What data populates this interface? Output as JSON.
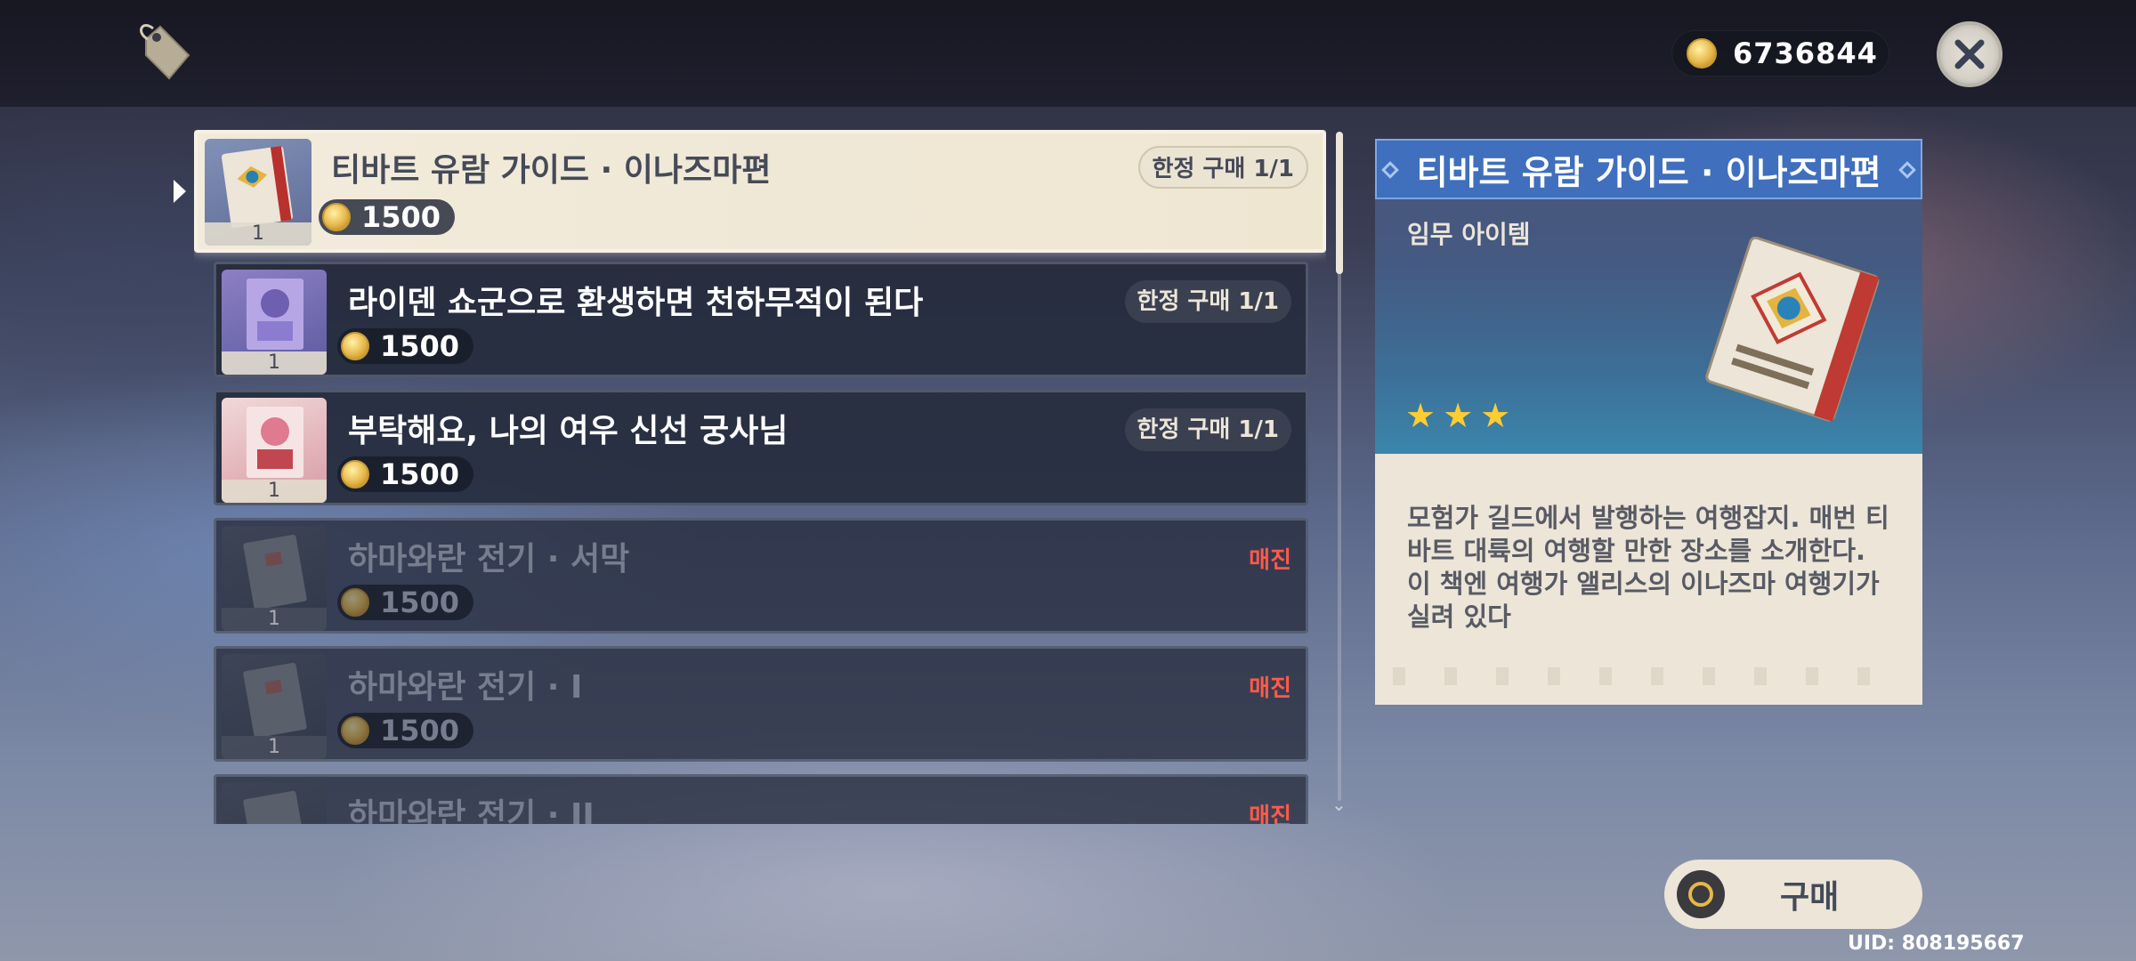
{
  "header": {
    "mora": "6736844"
  },
  "items": [
    {
      "name": "티바트 유람 가이드 · 이나즈마편",
      "price": "1500",
      "count": "1",
      "limit": "한정 구매 1/1",
      "status": "selected"
    },
    {
      "name": "라이덴 쇼군으로 환생하면 천하무적이 된다",
      "price": "1500",
      "count": "1",
      "limit": "한정 구매 1/1",
      "status": "available"
    },
    {
      "name": "부탁해요, 나의 여우 신선 궁사님",
      "price": "1500",
      "count": "1",
      "limit": "한정 구매 1/1",
      "status": "available"
    },
    {
      "name": "하마와란 전기 · 서막",
      "price": "1500",
      "count": "1",
      "soldout": "매진",
      "status": "soldout"
    },
    {
      "name": "하마와란 전기 · I",
      "price": "1500",
      "count": "1",
      "soldout": "매진",
      "status": "soldout"
    },
    {
      "name": "하마와란 전기 · II",
      "soldout": "매진",
      "status": "soldout"
    }
  ],
  "detail": {
    "title": "티바트 유람 가이드 · 이나즈마편",
    "type": "임무 아이템",
    "rarity": 3,
    "description": "모험가 길드에서 발행하는 여행잡지. 매번 티바트 대륙의 여행할 만한 장소를 소개한다. 이 책엔 여행가 앨리스의 이나즈마 여행기가 실려 있다"
  },
  "buy": {
    "label": "구매"
  },
  "uid": "UID: 808195667",
  "colors": {
    "accent_blue": "#3f6fbd",
    "soldout_red": "#ff5a4a",
    "star": "#ffcc32",
    "cream": "#ece5d8"
  }
}
